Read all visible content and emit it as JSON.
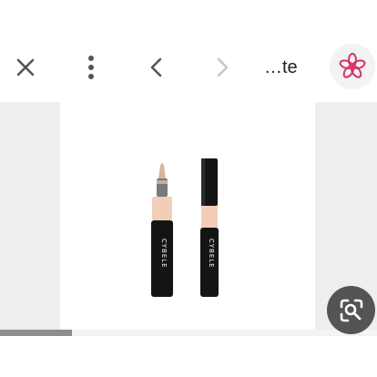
{
  "header": {
    "title_fragment": "…te",
    "close_icon": "close-icon",
    "more_icon": "more-vertical-icon",
    "back_icon": "chevron-left-icon",
    "forward_icon": "chevron-right-icon",
    "lens_icon": "flower-icon"
  },
  "product_image": {
    "brand_text": "CYBELE",
    "shade_color": "#f2cdb8",
    "body_color": "#141414"
  },
  "gallery": {
    "progress_fraction": 0.19
  },
  "actions": {
    "visual_search_icon": "visual-search-icon"
  },
  "colors": {
    "icon_dark": "#555555",
    "icon_disabled": "#c6c6c6",
    "lens_accent": "#d6336c"
  }
}
